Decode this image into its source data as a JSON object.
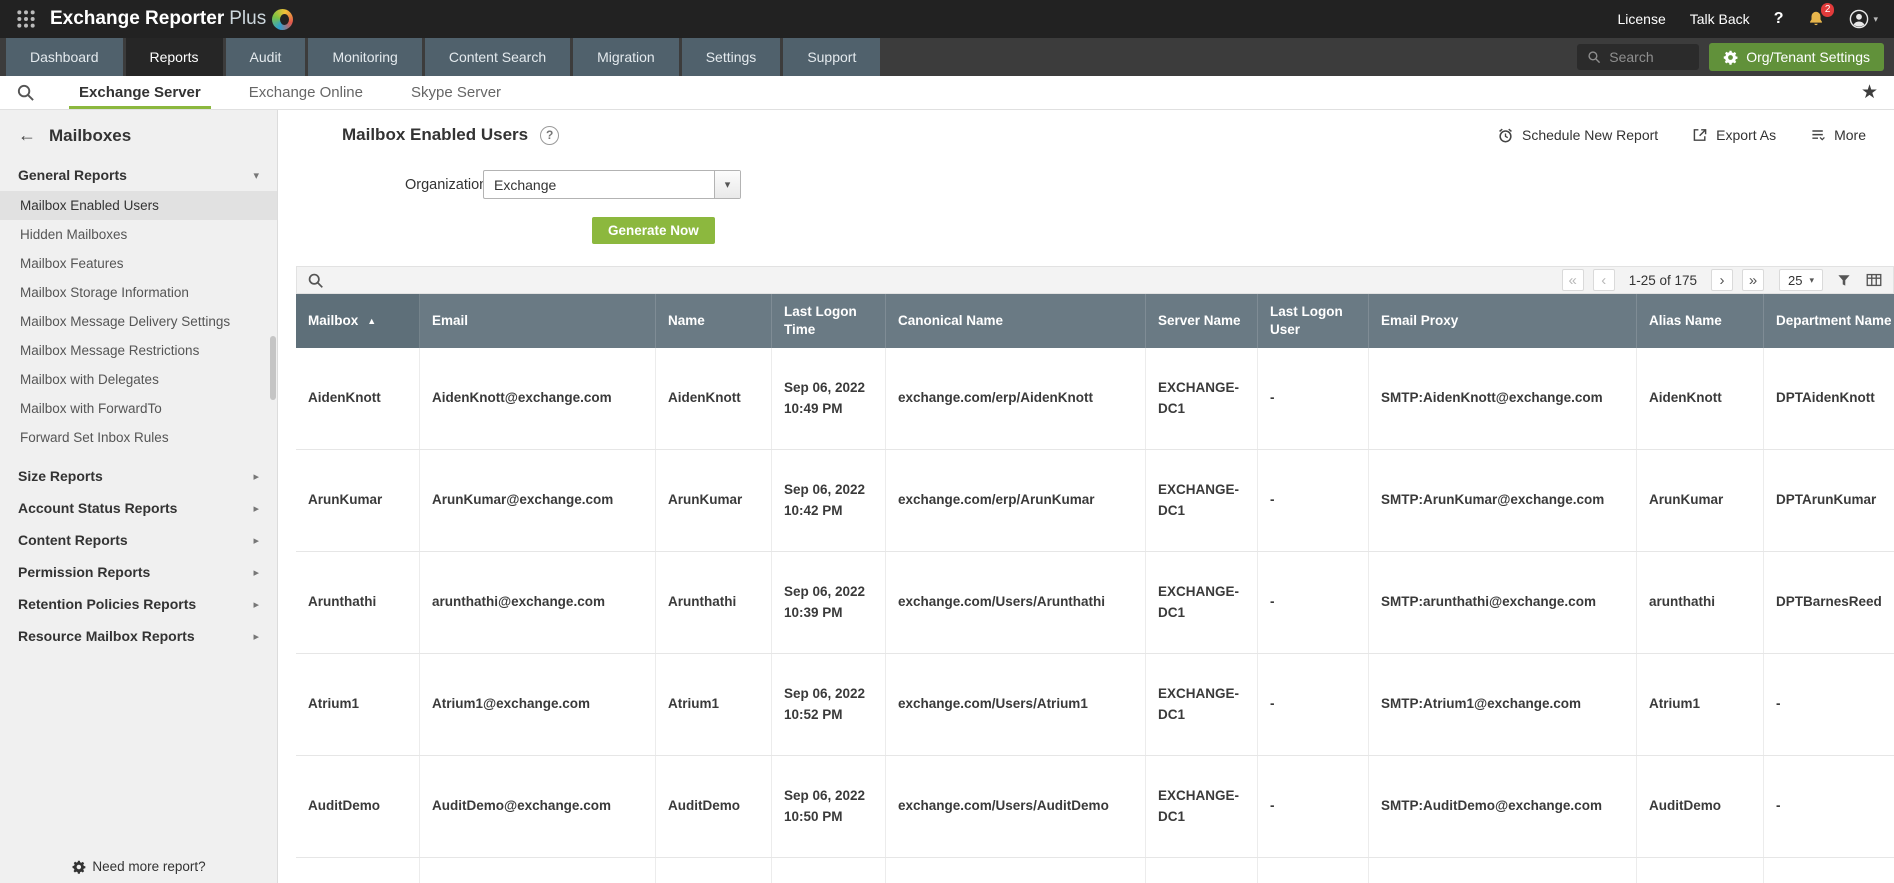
{
  "colors": {
    "topbar_bg": "#222222",
    "navbar_bg": "#3c3c3c",
    "nav_tab_bg": "#50616c",
    "nav_tab_active_bg": "#262626",
    "accent_green": "#8cb83e",
    "org_button_green": "#61913a",
    "table_header_bg": "#6a7a84",
    "notification_badge_red": "#e23b3b",
    "sidebar_bg": "#f0f0f0"
  },
  "icons": {
    "back_arrow": "←",
    "chevron_down": "▾",
    "chevron_right": "▸",
    "star": "★",
    "help": "?",
    "sort_asc": "▲",
    "select_caret": "▾",
    "pg_first": "«",
    "pg_prev": "‹",
    "pg_next": "›",
    "pg_last": "»",
    "user_caret": "▾"
  },
  "topbar": {
    "brand_name": "Exchange Reporter",
    "brand_suffix": "Plus",
    "license_label": "License",
    "talkback_label": "Talk Back",
    "help_label": "?",
    "notification_count": "2"
  },
  "nav": {
    "tabs": [
      {
        "label": "Dashboard",
        "active": false
      },
      {
        "label": "Reports",
        "active": true
      },
      {
        "label": "Audit",
        "active": false
      },
      {
        "label": "Monitoring",
        "active": false
      },
      {
        "label": "Content Search",
        "active": false
      },
      {
        "label": "Migration",
        "active": false
      },
      {
        "label": "Settings",
        "active": false
      },
      {
        "label": "Support",
        "active": false
      }
    ],
    "search_placeholder": "Search",
    "org_tenant_settings_label": "Org/Tenant Settings"
  },
  "subnav": {
    "tabs": [
      {
        "label": "Exchange Server",
        "active": true
      },
      {
        "label": "Exchange Online",
        "active": false
      },
      {
        "label": "Skype Server",
        "active": false
      }
    ]
  },
  "sidebar": {
    "title": "Mailboxes",
    "expanded_section": {
      "label": "General Reports",
      "items": [
        {
          "label": "Mailbox Enabled Users",
          "selected": true
        },
        {
          "label": "Hidden Mailboxes",
          "selected": false
        },
        {
          "label": "Mailbox Features",
          "selected": false
        },
        {
          "label": "Mailbox Storage Information",
          "selected": false
        },
        {
          "label": "Mailbox Message Delivery Settings",
          "selected": false
        },
        {
          "label": "Mailbox Message Restrictions",
          "selected": false
        },
        {
          "label": "Mailbox with Delegates",
          "selected": false
        },
        {
          "label": "Mailbox with ForwardTo",
          "selected": false
        },
        {
          "label": "Forward Set Inbox Rules",
          "selected": false
        }
      ]
    },
    "collapsed_sections": [
      "Size Reports",
      "Account Status Reports",
      "Content Reports",
      "Permission Reports",
      "Retention Policies Reports",
      "Resource Mailbox Reports"
    ],
    "footer_link": "Need more report?"
  },
  "main": {
    "title": "Mailbox Enabled Users",
    "actions": {
      "schedule": "Schedule New Report",
      "export": "Export As",
      "more": "More"
    },
    "form": {
      "organization_label": "Organization",
      "organization_value": "Exchange",
      "generate_button": "Generate Now"
    },
    "toolbar": {
      "pagination_range": "1-25 of 175",
      "page_size": "25"
    },
    "table": {
      "sorted_column": "Mailbox",
      "sort_direction": "asc",
      "columns": [
        "Mailbox",
        "Email",
        "Name",
        "Last Logon Time",
        "Canonical Name",
        "Server Name",
        "Last Logon User",
        "Email Proxy",
        "Alias Name",
        "Department Name"
      ],
      "rows": [
        {
          "mailbox": "AidenKnott",
          "email": "AidenKnott@exchange.com",
          "name": "AidenKnott",
          "logon_date": "Sep 06, 2022",
          "logon_time": "10:49 PM",
          "canonical": "exchange.com/erp/AidenKnott",
          "server": "EXCHANGE-DC1",
          "logon_user": "-",
          "proxy": "SMTP:AidenKnott@exchange.com",
          "alias": "AidenKnott",
          "department": "DPTAidenKnott"
        },
        {
          "mailbox": "ArunKumar",
          "email": "ArunKumar@exchange.com",
          "name": "ArunKumar",
          "logon_date": "Sep 06, 2022",
          "logon_time": "10:42 PM",
          "canonical": "exchange.com/erp/ArunKumar",
          "server": "EXCHANGE-DC1",
          "logon_user": "-",
          "proxy": "SMTP:ArunKumar@exchange.com",
          "alias": "ArunKumar",
          "department": "DPTArunKumar"
        },
        {
          "mailbox": "Arunthathi",
          "email": "arunthathi@exchange.com",
          "name": "Arunthathi",
          "logon_date": "Sep 06, 2022",
          "logon_time": "10:39 PM",
          "canonical": "exchange.com/Users/Arunthathi",
          "server": "EXCHANGE-DC1",
          "logon_user": "-",
          "proxy": "SMTP:arunthathi@exchange.com",
          "alias": "arunthathi",
          "department": "DPTBarnesReed"
        },
        {
          "mailbox": "Atrium1",
          "email": "Atrium1@exchange.com",
          "name": "Atrium1",
          "logon_date": "Sep 06, 2022",
          "logon_time": "10:52 PM",
          "canonical": "exchange.com/Users/Atrium1",
          "server": "EXCHANGE-DC1",
          "logon_user": "-",
          "proxy": "SMTP:Atrium1@exchange.com",
          "alias": "Atrium1",
          "department": "-"
        },
        {
          "mailbox": "AuditDemo",
          "email": "AuditDemo@exchange.com",
          "name": "AuditDemo",
          "logon_date": "Sep 06, 2022",
          "logon_time": "10:50 PM",
          "canonical": "exchange.com/Users/AuditDemo",
          "server": "EXCHANGE-DC1",
          "logon_user": "-",
          "proxy": "SMTP:AuditDemo@exchange.com",
          "alias": "AuditDemo",
          "department": "-"
        }
      ]
    }
  }
}
